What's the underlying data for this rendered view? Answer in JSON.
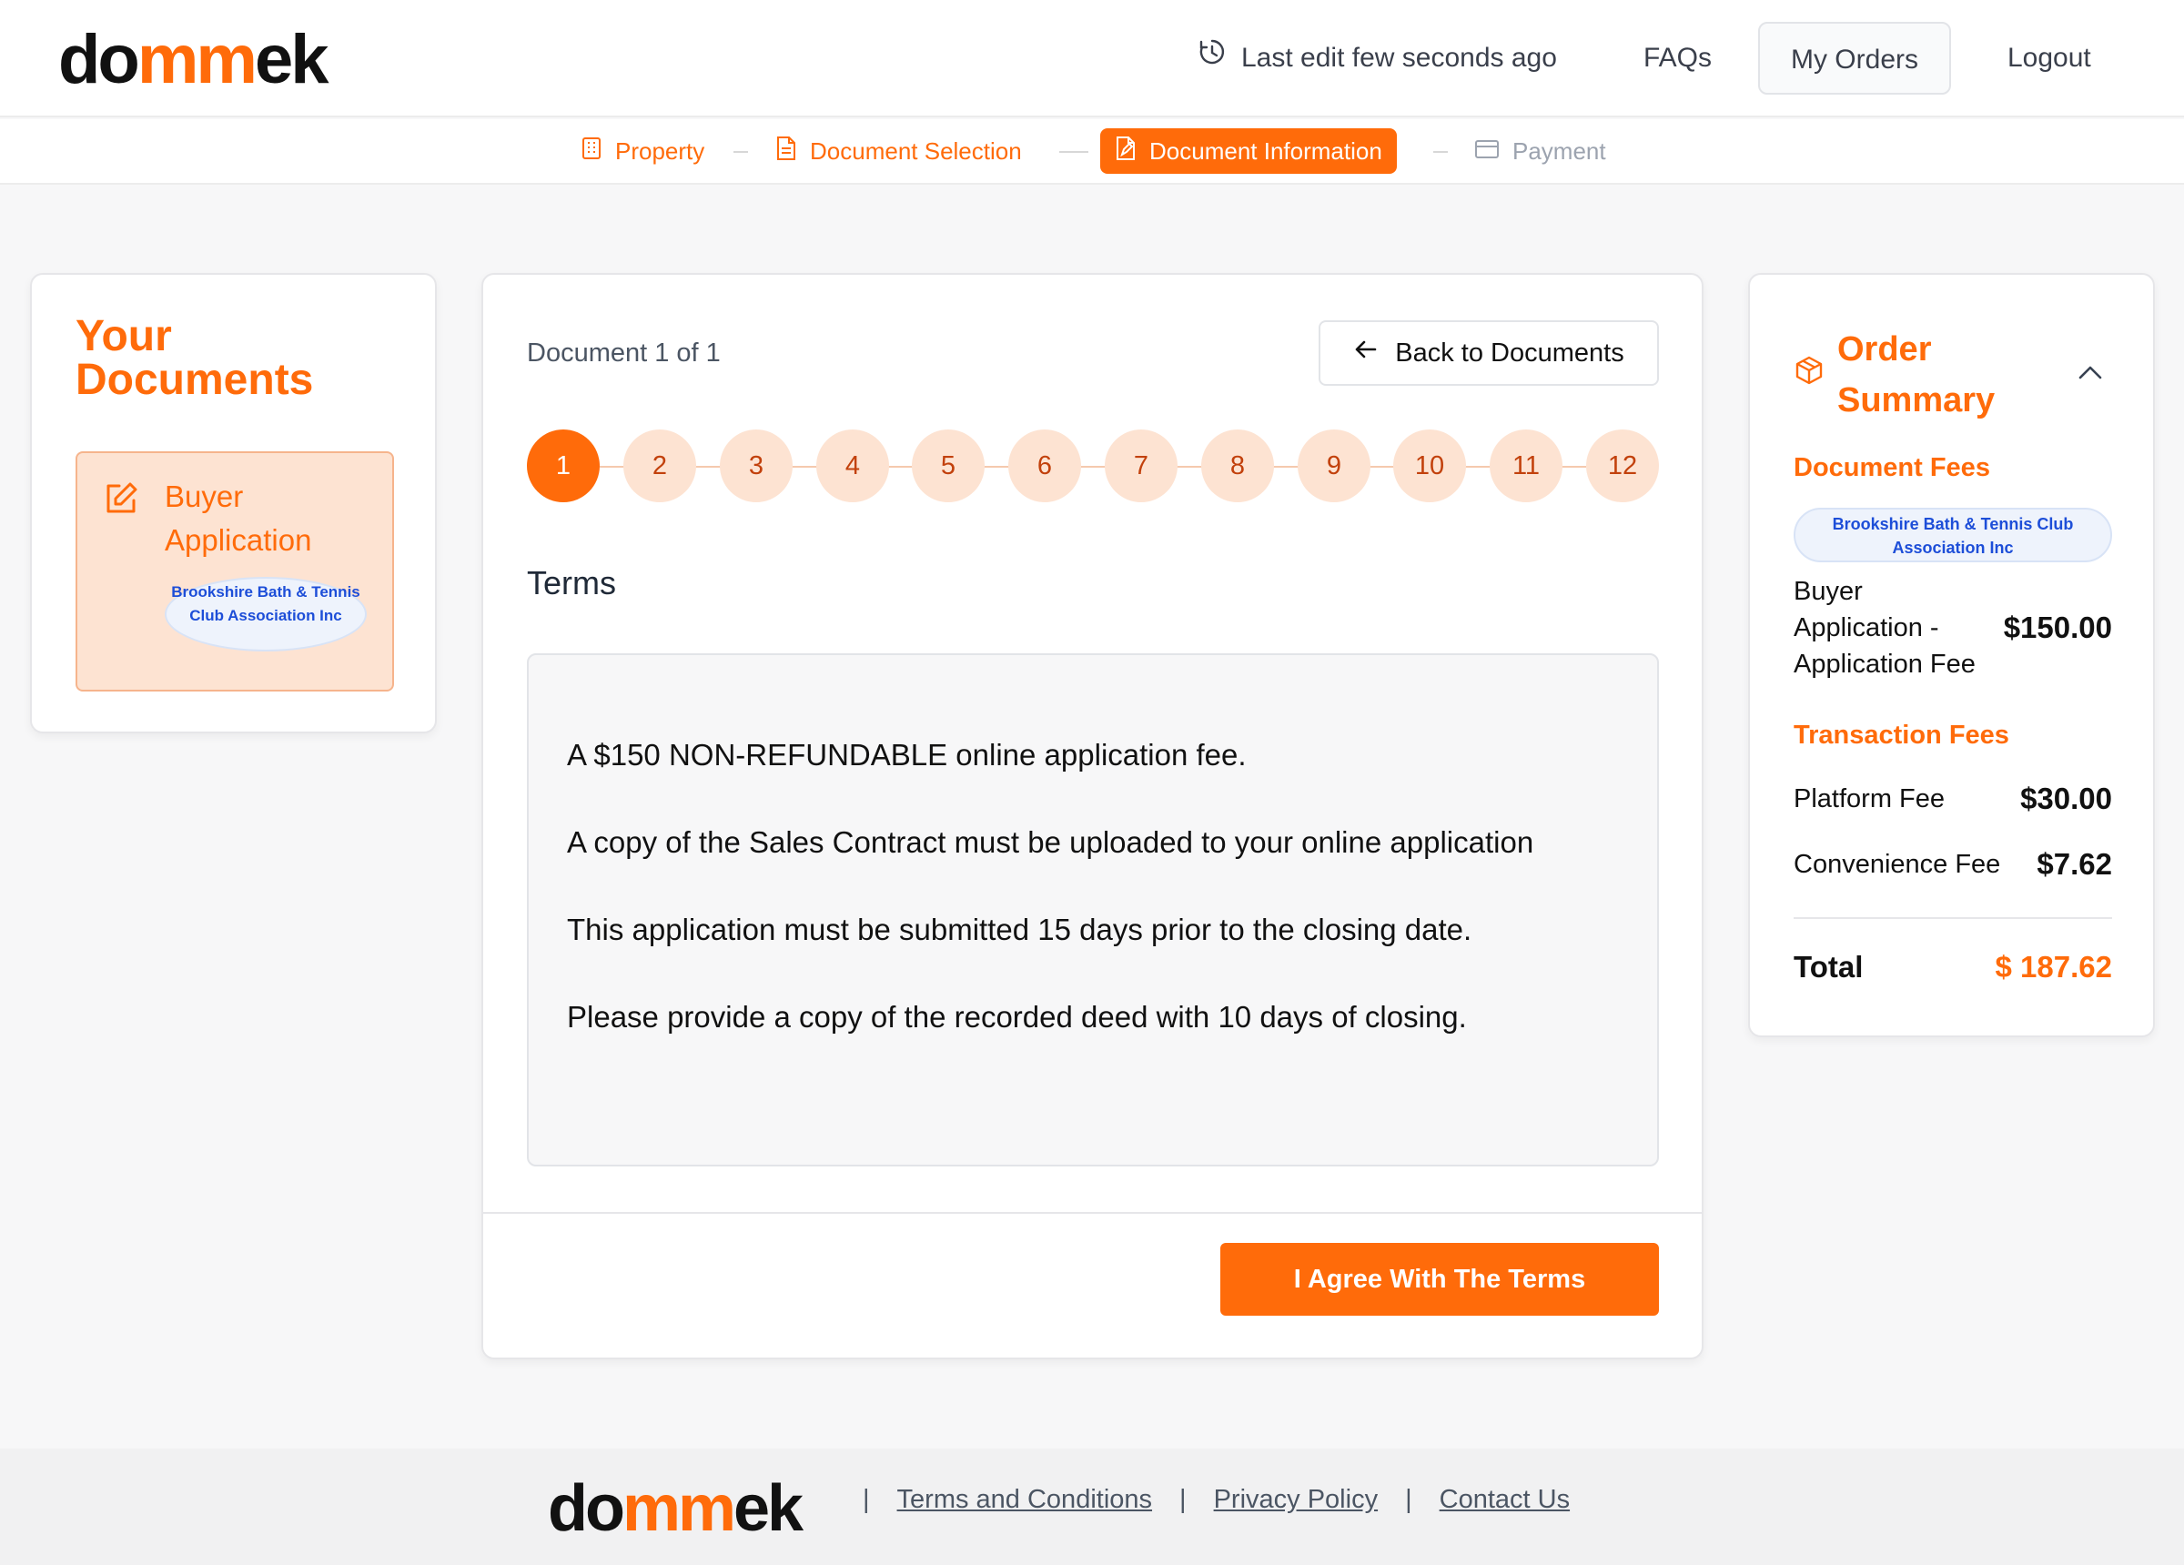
{
  "brand": {
    "logo_prefix": "do",
    "logo_mm": "mm",
    "logo_suffix": "ek",
    "accent": "#ff6b0a"
  },
  "header": {
    "last_edit": "Last edit few seconds ago",
    "faqs": "FAQs",
    "my_orders": "My Orders",
    "logout": "Logout"
  },
  "stepper": {
    "steps": [
      {
        "label": "Property",
        "icon": "building-icon",
        "state": "done"
      },
      {
        "label": "Document Selection",
        "icon": "document-icon",
        "state": "done"
      },
      {
        "label": "Document Information",
        "icon": "document-edit-icon",
        "state": "active"
      },
      {
        "label": "Payment",
        "icon": "credit-card-icon",
        "state": "inactive"
      }
    ]
  },
  "sidebar": {
    "title": "Your Documents",
    "documents": [
      {
        "name": "Buyer Application",
        "association": "Brookshire Bath & Tennis Club Association Inc"
      }
    ]
  },
  "main": {
    "doc_counter": "Document 1 of 1",
    "back_button": "Back to Documents",
    "pages": [
      "1",
      "2",
      "3",
      "4",
      "5",
      "6",
      "7",
      "8",
      "9",
      "10",
      "11",
      "12"
    ],
    "current_page": "1",
    "section_title": "Terms",
    "terms": [
      "A $150 NON-REFUNDABLE online application fee.",
      "A copy of the Sales Contract must be uploaded to your online application",
      "This application must be submitted 15 days prior to the closing date.",
      "Please provide a copy of the recorded deed with 10 days of closing."
    ],
    "agree_button": "I Agree With The Terms"
  },
  "order_summary": {
    "title": "Order Summary",
    "document_fees_label": "Document Fees",
    "association": "Brookshire Bath & Tennis Club Association Inc",
    "document_fee_item": "Buyer Application - Application Fee",
    "document_fee_amount": "$150.00",
    "transaction_fees_label": "Transaction Fees",
    "platform_fee_label": "Platform Fee",
    "platform_fee_amount": "$30.00",
    "convenience_fee_label": "Convenience Fee",
    "convenience_fee_amount": "$7.62",
    "total_label": "Total",
    "total_amount": "$ 187.62"
  },
  "footer": {
    "links": [
      "Terms and Conditions",
      "Privacy Policy",
      "Contact Us"
    ],
    "separator": "|"
  }
}
